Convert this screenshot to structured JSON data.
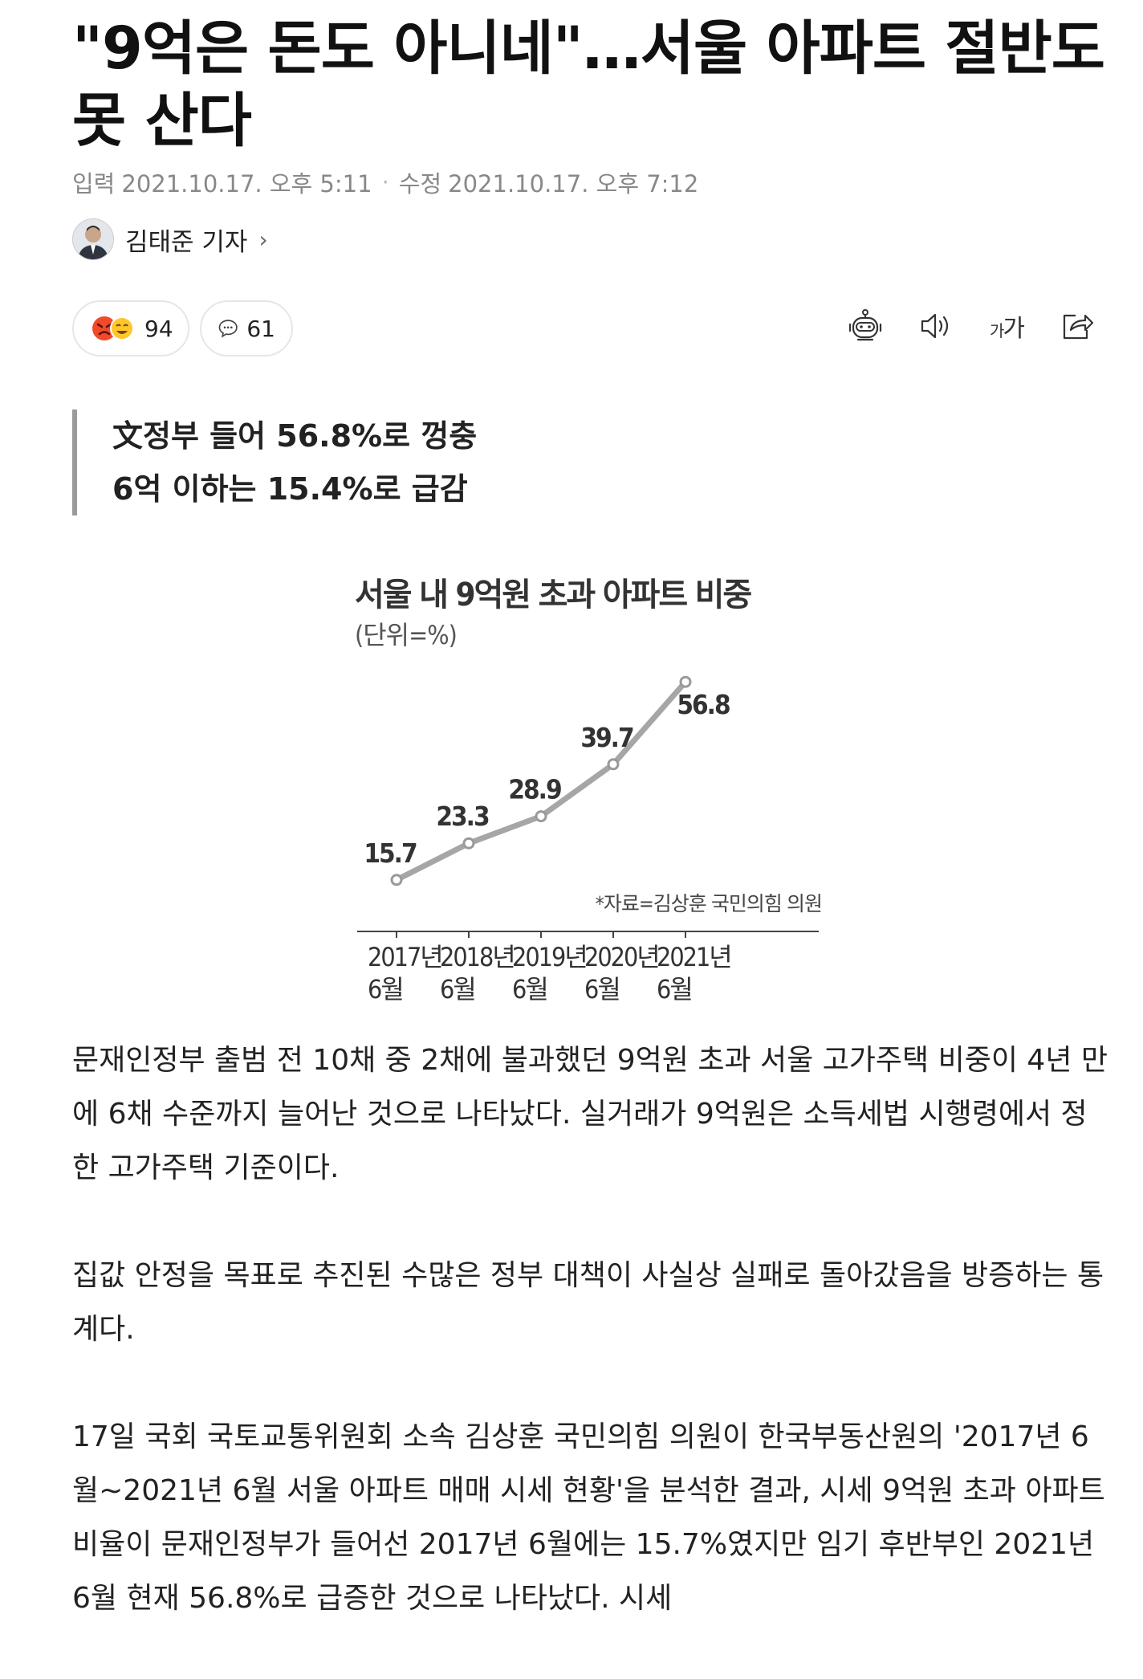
{
  "article": {
    "title_line1": "\"9억은 돈도 아니네\"…서울 아파트 절반도",
    "title_line2": "못 산다",
    "input_label": "입력",
    "input_time": "2021.10.17. 오후 5:11",
    "modified_label": "수정",
    "modified_time": "2021.10.17. 오후 7:12",
    "author": "김태준 기자",
    "reaction_count": "94",
    "comment_count": "61",
    "font_size_label": "가가",
    "summary": [
      "文정부 들어 56.8%로 껑충",
      "6억 이하는 15.4%로 급감"
    ],
    "paragraphs": [
      "문재인정부 출범 전 10채 중 2채에 불과했던 9억원 초과 서울 고가주택 비중이 4년 만에 6채 수준까지 늘어난 것으로 나타났다. 실거래가 9억원은 소득세법 시행령에서 정한 고가주택 기준이다.",
      "집값 안정을 목표로 추진된 수많은 정부 대책이 사실상 실패로 돌아갔음을 방증하는 통계다.",
      "17일 국회 국토교통위원회 소속 김상훈 국민의힘 의원이 한국부동산원의 '2017년 6월~2021년 6월 서울 아파트 매매 시세 현황'을 분석한 결과, 시세 9억원 초과 아파트 비율이 문재인정부가 들어선 2017년 6월에는 15.7%였지만 임기 후반부인 2021년 6월 현재 56.8%로 급증한 것으로 나타났다. 시세"
    ]
  },
  "icons": [
    "angry-face-icon",
    "laughing-face-icon",
    "comment-icon",
    "robot-icon",
    "speaker-icon",
    "font-size-icon",
    "share-icon",
    "chevron-right-icon"
  ],
  "colors": {
    "chart_line": "#a6a6a6",
    "summary_bar": "#9b9b9b",
    "meta": "#888888"
  },
  "chart_data": {
    "type": "line",
    "title": "서울 내 9억원 초과 아파트 비중",
    "subtitle": "(단위=%)",
    "source": "*자료=김상훈 국민의힘 의원",
    "categories": [
      [
        "2017년",
        "6월"
      ],
      [
        "2018년",
        "6월"
      ],
      [
        "2019년",
        "6월"
      ],
      [
        "2020년",
        "6월"
      ],
      [
        "2021년",
        "6월"
      ]
    ],
    "values": [
      15.7,
      23.3,
      28.9,
      39.7,
      56.8
    ],
    "labels": [
      "15.7",
      "23.3",
      "28.9",
      "39.7",
      "56.8"
    ],
    "ylim": [
      5,
      60
    ],
    "grid": false
  }
}
